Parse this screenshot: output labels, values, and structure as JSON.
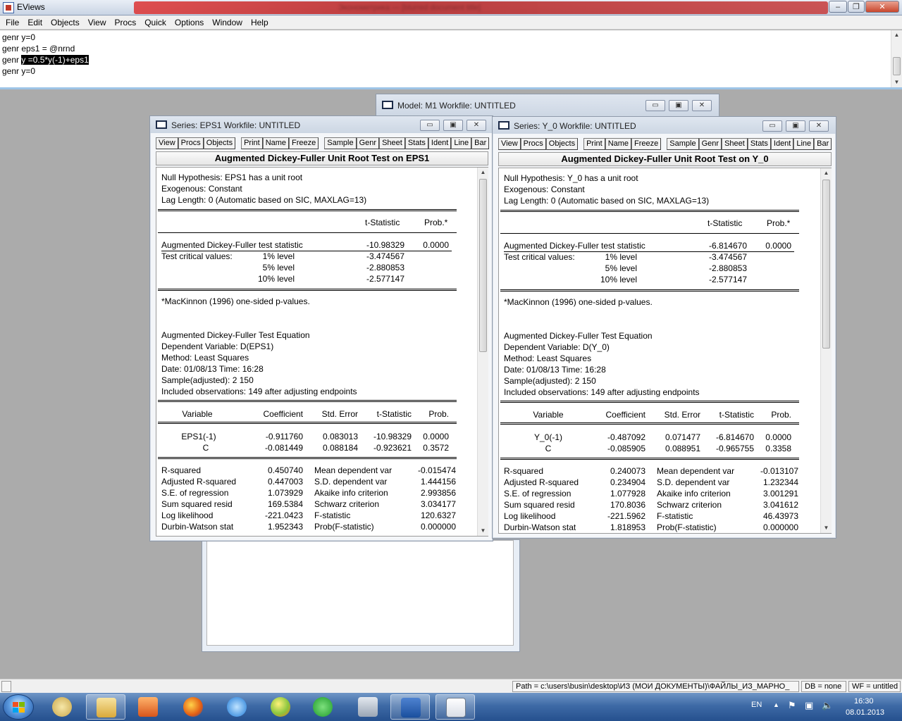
{
  "app": {
    "title": "EViews",
    "blurred_title": "Эконометрика — [blurred document title]"
  },
  "menu": [
    "File",
    "Edit",
    "Objects",
    "View",
    "Procs",
    "Quick",
    "Options",
    "Window",
    "Help"
  ],
  "command_lines": [
    {
      "pre": "genr y=0",
      "sel": ""
    },
    {
      "pre": "genr eps1 = @nrnd",
      "sel": ""
    },
    {
      "pre": "genr ",
      "sel": "y =0.5*y(-1)+eps1"
    },
    {
      "pre": "genr y=0",
      "sel": ""
    }
  ],
  "model_window": {
    "title": "Model: M1   Workfile: UNTITLED"
  },
  "toolbar": [
    "View",
    "Procs",
    "Objects",
    "|",
    "Print",
    "Name",
    "Freeze",
    "|",
    "Sample",
    "Genr",
    "Sheet",
    "Stats",
    "Ident",
    "Line",
    "Bar"
  ],
  "eps1": {
    "title": "Series: EPS1   Workfile: UNTITLED",
    "header": "Augmented Dickey-Fuller Unit Root Test on EPS1",
    "null_hyp": "Null Hypothesis: EPS1 has a unit root",
    "exog": "Exogenous: Constant",
    "lag": "Lag Length: 0 (Automatic based on SIC, MAXLAG=13)",
    "t_stat_head": "t-Statistic",
    "prob_head": "Prob.*",
    "adf_label": "Augmented Dickey-Fuller test statistic",
    "adf_t": "-10.98329",
    "adf_p": "0.0000",
    "crit_label": "Test critical values:",
    "crit": [
      {
        "lvl": "1% level",
        "v": "-3.474567"
      },
      {
        "lvl": "5% level",
        "v": "-2.880853"
      },
      {
        "lvl": "10% level",
        "v": "-2.577147"
      }
    ],
    "mackinnon": "*MacKinnon (1996) one-sided p-values.",
    "eq_title": "Augmented Dickey-Fuller Test Equation",
    "dep": "Dependent Variable: D(EPS1)",
    "method": "Method: Least Squares",
    "date": "Date: 01/08/13   Time: 16:28",
    "sample": "Sample(adjusted): 2 150",
    "obs": "Included observations: 149 after adjusting endpoints",
    "coef_head": [
      "Variable",
      "Coefficient",
      "Std. Error",
      "t-Statistic",
      "Prob."
    ],
    "coefs": [
      [
        "EPS1(-1)",
        "-0.911760",
        "0.083013",
        "-10.98329",
        "0.0000"
      ],
      [
        "C",
        "-0.081449",
        "0.088184",
        "-0.923621",
        "0.3572"
      ]
    ],
    "stats": [
      [
        "R-squared",
        "0.450740",
        "Mean dependent var",
        "-0.015474"
      ],
      [
        "Adjusted R-squared",
        "0.447003",
        "S.D. dependent var",
        "1.444156"
      ],
      [
        "S.E. of regression",
        "1.073929",
        "Akaike info criterion",
        "2.993856"
      ],
      [
        "Sum squared resid",
        "169.5384",
        "Schwarz criterion",
        "3.034177"
      ],
      [
        "Log likelihood",
        "-221.0423",
        "F-statistic",
        "120.6327"
      ],
      [
        "Durbin-Watson stat",
        "1.952343",
        "Prob(F-statistic)",
        "0.000000"
      ]
    ]
  },
  "y0": {
    "title": "Series: Y_0   Workfile: UNTITLED",
    "header": "Augmented Dickey-Fuller Unit Root Test on Y_0",
    "null_hyp": "Null Hypothesis: Y_0 has a unit root",
    "exog": "Exogenous: Constant",
    "lag": "Lag Length: 0 (Automatic based on SIC, MAXLAG=13)",
    "t_stat_head": "t-Statistic",
    "prob_head": "Prob.*",
    "adf_label": "Augmented Dickey-Fuller test statistic",
    "adf_t": "-6.814670",
    "adf_p": "0.0000",
    "crit_label": "Test critical values:",
    "crit": [
      {
        "lvl": "1% level",
        "v": "-3.474567"
      },
      {
        "lvl": "5% level",
        "v": "-2.880853"
      },
      {
        "lvl": "10% level",
        "v": "-2.577147"
      }
    ],
    "mackinnon": "*MacKinnon (1996) one-sided p-values.",
    "eq_title": "Augmented Dickey-Fuller Test Equation",
    "dep": "Dependent Variable: D(Y_0)",
    "method": "Method: Least Squares",
    "date": "Date: 01/08/13   Time: 16:28",
    "sample": "Sample(adjusted): 2 150",
    "obs": "Included observations: 149 after adjusting endpoints",
    "coef_head": [
      "Variable",
      "Coefficient",
      "Std. Error",
      "t-Statistic",
      "Prob."
    ],
    "coefs": [
      [
        "Y_0(-1)",
        "-0.487092",
        "0.071477",
        "-6.814670",
        "0.0000"
      ],
      [
        "C",
        "-0.085905",
        "0.088951",
        "-0.965755",
        "0.3358"
      ]
    ],
    "stats": [
      [
        "R-squared",
        "0.240073",
        "Mean dependent var",
        "-0.013107"
      ],
      [
        "Adjusted R-squared",
        "0.234904",
        "S.D. dependent var",
        "1.232344"
      ],
      [
        "S.E. of regression",
        "1.077928",
        "Akaike info criterion",
        "3.001291"
      ],
      [
        "Sum squared resid",
        "170.8036",
        "Schwarz criterion",
        "3.041612"
      ],
      [
        "Log likelihood",
        "-221.5962",
        "F-statistic",
        "46.43973"
      ],
      [
        "Durbin-Watson stat",
        "1.818953",
        "Prob(F-statistic)",
        "0.000000"
      ]
    ]
  },
  "status": {
    "path": "Path = c:\\users\\busin\\desktop\\ИЗ (МОИ ДОКУМЕНТЫ)\\ФАЙЛЫ_ИЗ_МАРНО_",
    "db": "DB = none",
    "wf": "WF = untitled"
  },
  "taskbar": {
    "apps": [
      "windows-explorer",
      "media-player",
      "firefox",
      "internet-explorer",
      "chrome-like-ball",
      "mail-agent",
      "calculator",
      "word",
      "eviews"
    ],
    "lang": "EN",
    "time": "16:30",
    "date": "08.01.2013"
  },
  "colors": {
    "title_red": "#c63a3a",
    "selection": "#000000",
    "taskbar": "#3e6aa6",
    "workspace": "#ababab"
  }
}
